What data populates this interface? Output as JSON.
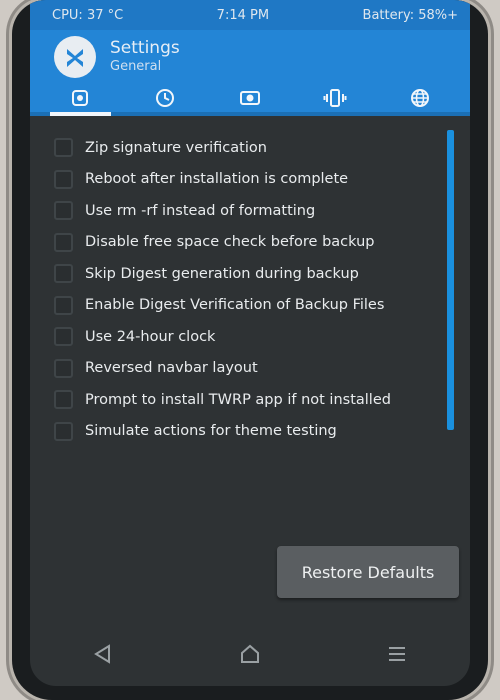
{
  "status": {
    "cpu": "CPU: 37 °C",
    "time": "7:14 PM",
    "battery": "Battery: 58%+"
  },
  "header": {
    "title": "Settings",
    "subtitle": "General"
  },
  "tabs": [
    {
      "icon": "gear-icon",
      "active": true
    },
    {
      "icon": "clock-icon",
      "active": false
    },
    {
      "icon": "brightness-icon",
      "active": false
    },
    {
      "icon": "vibrate-icon",
      "active": false
    },
    {
      "icon": "globe-icon",
      "active": false
    }
  ],
  "options": [
    {
      "label": "Zip signature verification",
      "checked": false
    },
    {
      "label": "Reboot after installation is complete",
      "checked": false
    },
    {
      "label": "Use rm -rf instead of formatting",
      "checked": false
    },
    {
      "label": "Disable free space check before backup",
      "checked": false
    },
    {
      "label": "Skip Digest generation during backup",
      "checked": false
    },
    {
      "label": "Enable Digest Verification of Backup Files",
      "checked": false
    },
    {
      "label": "Use 24-hour clock",
      "checked": false
    },
    {
      "label": "Reversed navbar layout",
      "checked": false
    },
    {
      "label": "Prompt to install TWRP app if not installed",
      "checked": false
    },
    {
      "label": "Simulate actions for theme testing",
      "checked": false
    }
  ],
  "restore_button": "Restore Defaults",
  "navbar": {
    "back_icon": "back-triangle-icon",
    "home_icon": "home-icon",
    "menu_icon": "menu-icon"
  },
  "colors": {
    "accent": "#2385d6",
    "status_bar": "#1f78c5",
    "background": "#2e3234",
    "scrollbar": "#1a90de"
  }
}
